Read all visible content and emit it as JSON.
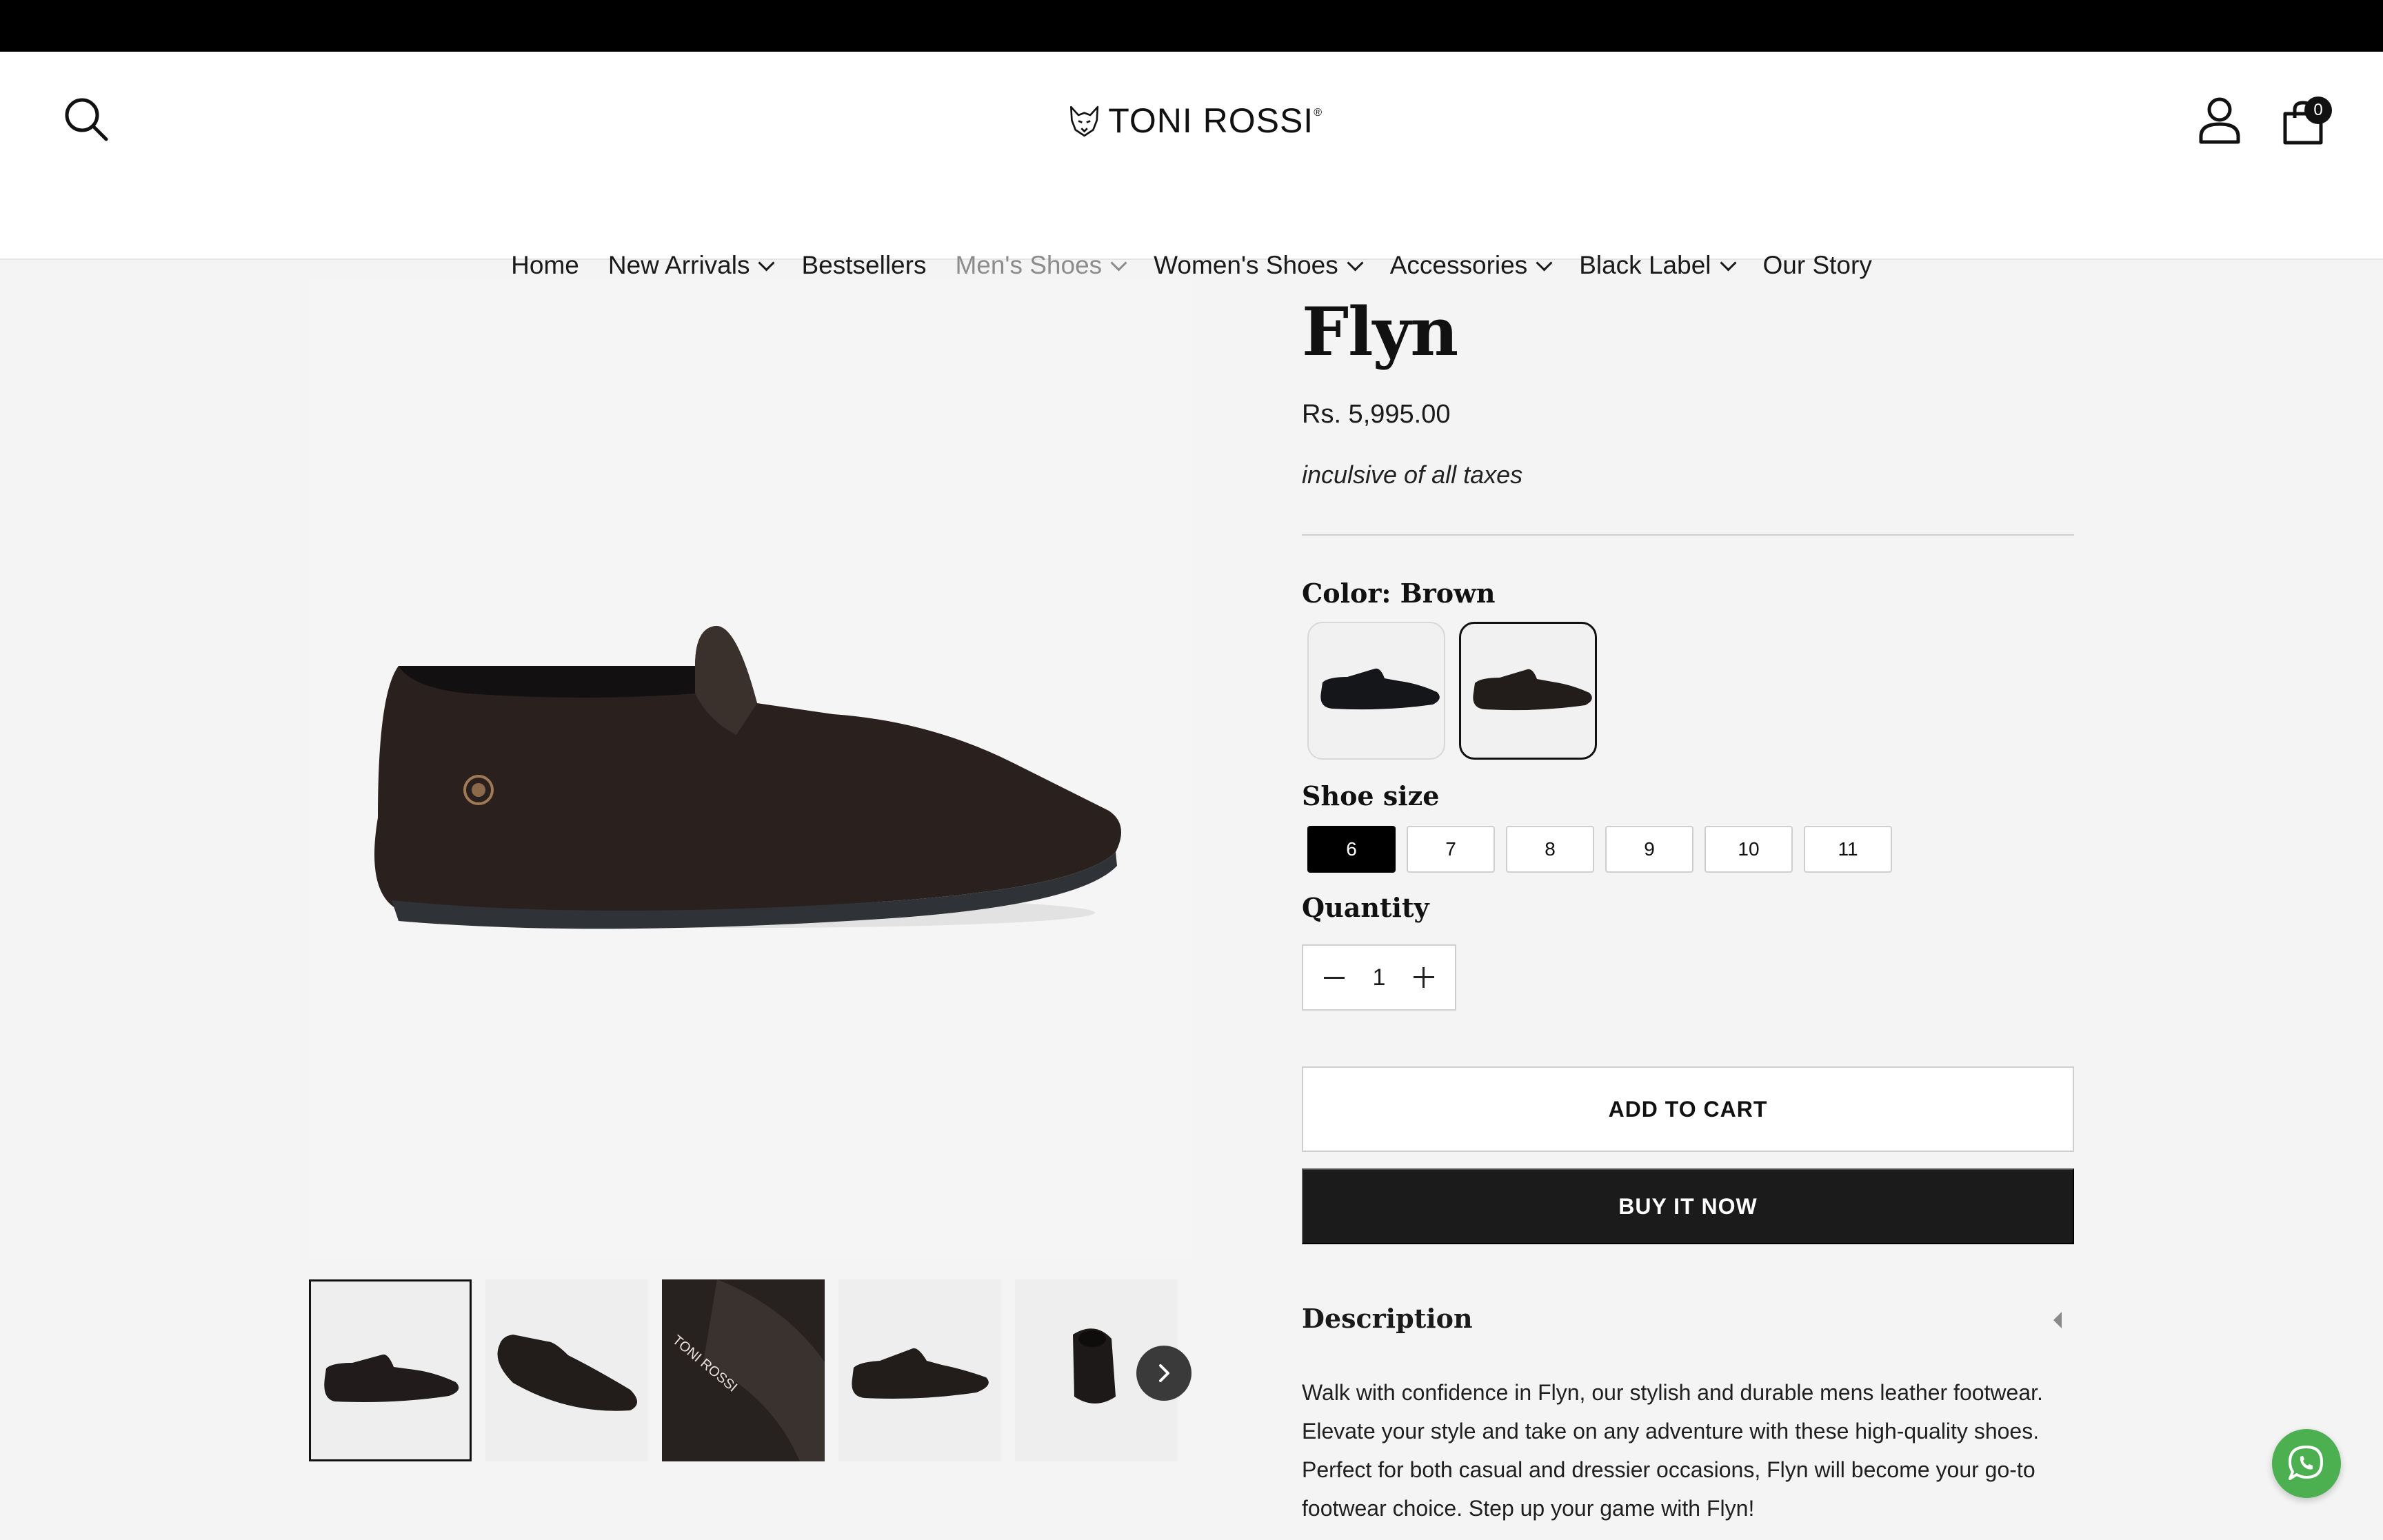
{
  "header": {
    "brand": "TONI ROSSI",
    "brand_mark": "®",
    "cart_count": "0",
    "icons": {
      "search": "search-icon",
      "account": "account-icon",
      "cart": "shopping-bag-icon"
    }
  },
  "nav": {
    "items": [
      {
        "label": "Home"
      },
      {
        "label": "New Arrivals"
      },
      {
        "label": "Bestsellers"
      },
      {
        "label": "Men's Shoes"
      },
      {
        "label": "Women's Shoes"
      },
      {
        "label": "Accessories"
      },
      {
        "label": "Black Label"
      },
      {
        "label": "Our Story"
      }
    ]
  },
  "product": {
    "title": "Flyn",
    "price": "Rs. 5,995.00",
    "tax_note": "inculsive of all taxes",
    "color_label": "Color: Brown",
    "size_label": "Shoe size",
    "sizes": [
      "6",
      "7",
      "8",
      "9",
      "10",
      "11"
    ],
    "selected_size": "6",
    "quantity_label": "Quantity",
    "quantity": "1",
    "add_to_cart": "ADD TO CART",
    "buy_now": "BUY IT NOW",
    "description_title": "Description",
    "description": "Walk with confidence in Flyn, our stylish and durable mens leather footwear. Elevate your style and take on any adventure with these high-quality shoes. Perfect for both casual and dressier occasions, Flyn will become your go-to footwear choice. Step up your game with Flyn!"
  },
  "gallery": {
    "thumbnail_count": 5,
    "thumb_logo_text": "TONI ROSSI"
  },
  "colors": {
    "accent": "#000000",
    "whatsapp": "#4caf50",
    "button_dark": "#1b1b1b"
  }
}
